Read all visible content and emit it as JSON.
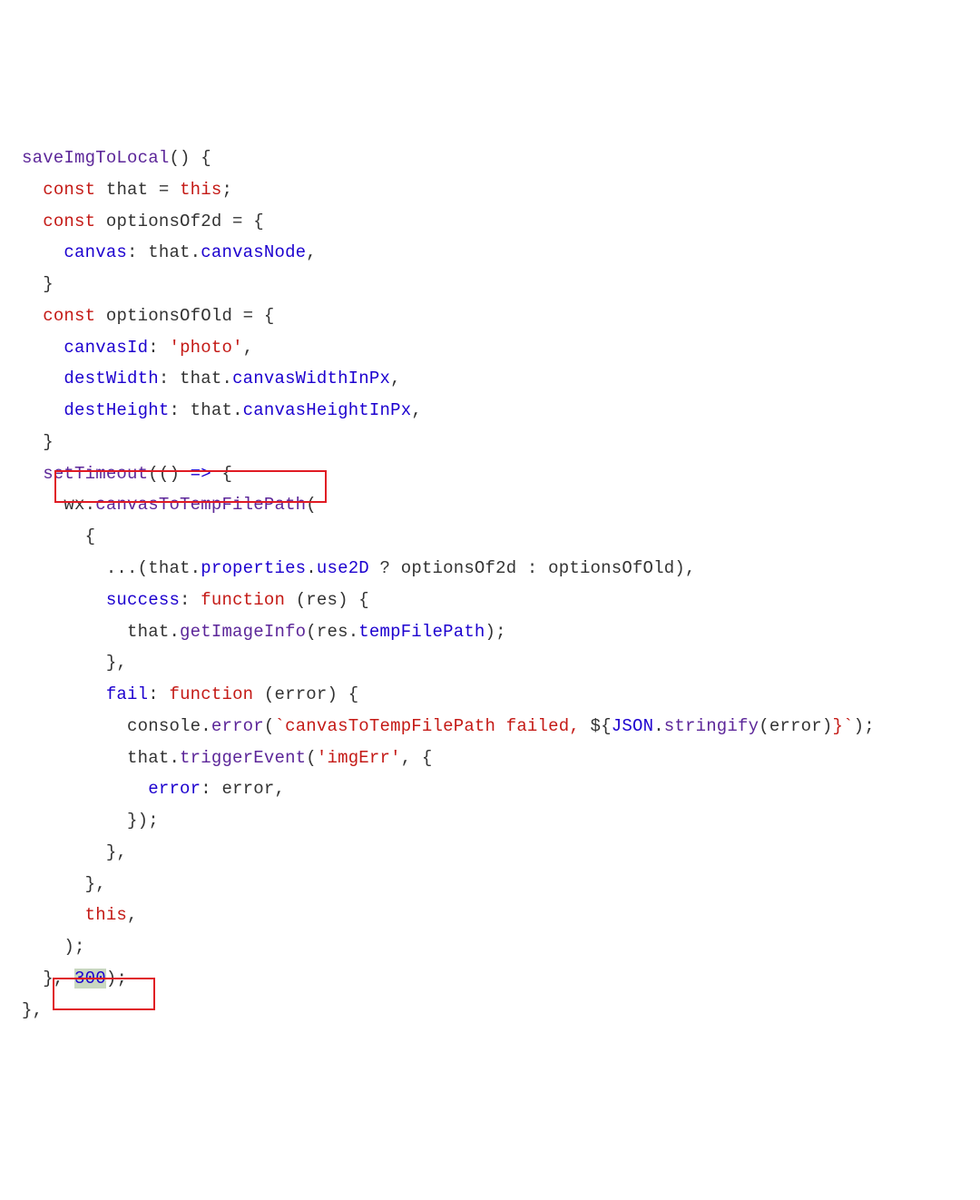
{
  "code": {
    "line1_fn": "saveImgToLocal",
    "const": "const",
    "this": "this",
    "function": "function",
    "that": "that",
    "optionsOf2d": "optionsOf2d",
    "optionsOfOld": "optionsOfOld",
    "canvas": "canvas",
    "canvasNode": "canvasNode",
    "canvasId": "canvasId",
    "photo_str": "'photo'",
    "destWidth": "destWidth",
    "destHeight": "destHeight",
    "canvasWidthInPx": "canvasWidthInPx",
    "canvasHeightInPx": "canvasHeightInPx",
    "setTimeout": "setTimeout",
    "arrow": "=>",
    "wx": "wx",
    "canvasToTempFilePath": "canvasToTempFilePath",
    "properties": "properties",
    "use2D": "use2D",
    "success": "success",
    "fail": "fail",
    "res": "res",
    "error": "error",
    "getImageInfo": "getImageInfo",
    "tempFilePath": "tempFilePath",
    "console": "console",
    "errorMethod": "error",
    "tmpl_open": "`canvasToTempFilePath failed, ",
    "tmpl_dollar": "${",
    "JSON": "JSON",
    "stringify": "stringify",
    "tmpl_close": "}`",
    "triggerEvent": "triggerEvent",
    "imgErr_str": "'imgErr'",
    "timeout_val": "300"
  }
}
